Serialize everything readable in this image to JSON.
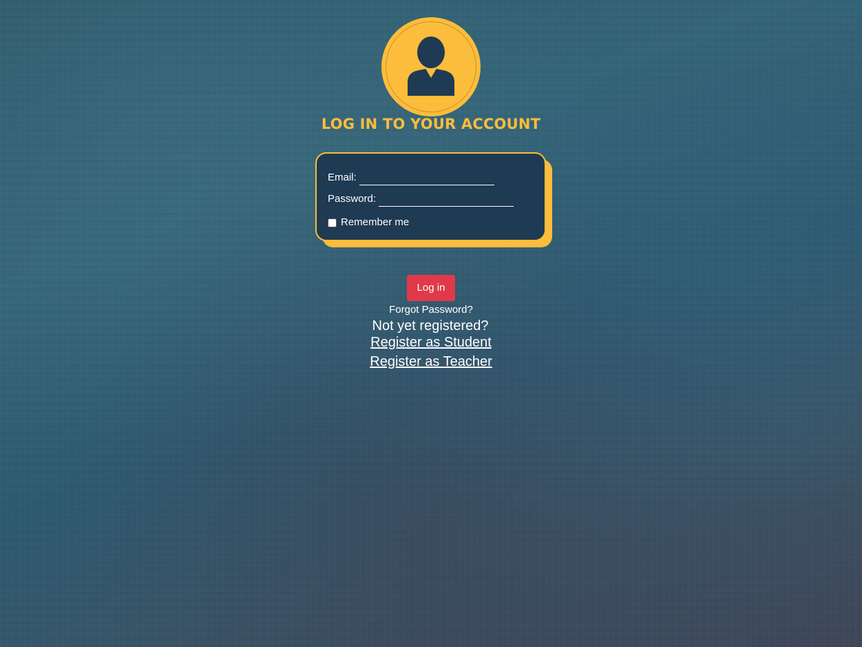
{
  "header": {
    "avatar_icon": "user-avatar-icon",
    "title": "LOG IN TO YOUR ACCOUNT"
  },
  "login_form": {
    "email_label": "Email:",
    "email_value": "",
    "password_label": "Password:",
    "password_value": "",
    "remember_label": "Remember me",
    "remember_checked": false
  },
  "actions": {
    "login_label": "Log in",
    "forgot_label": "Forgot Password?",
    "not_registered_text": "Not yet registered?",
    "register_student_label": "Register as Student",
    "register_teacher_label": "Register as Teacher"
  },
  "colors": {
    "accent": "#fbbd3b",
    "card_background": "#1f3a53",
    "button": "#e03a4a",
    "icon_fill": "#1f3a53"
  }
}
